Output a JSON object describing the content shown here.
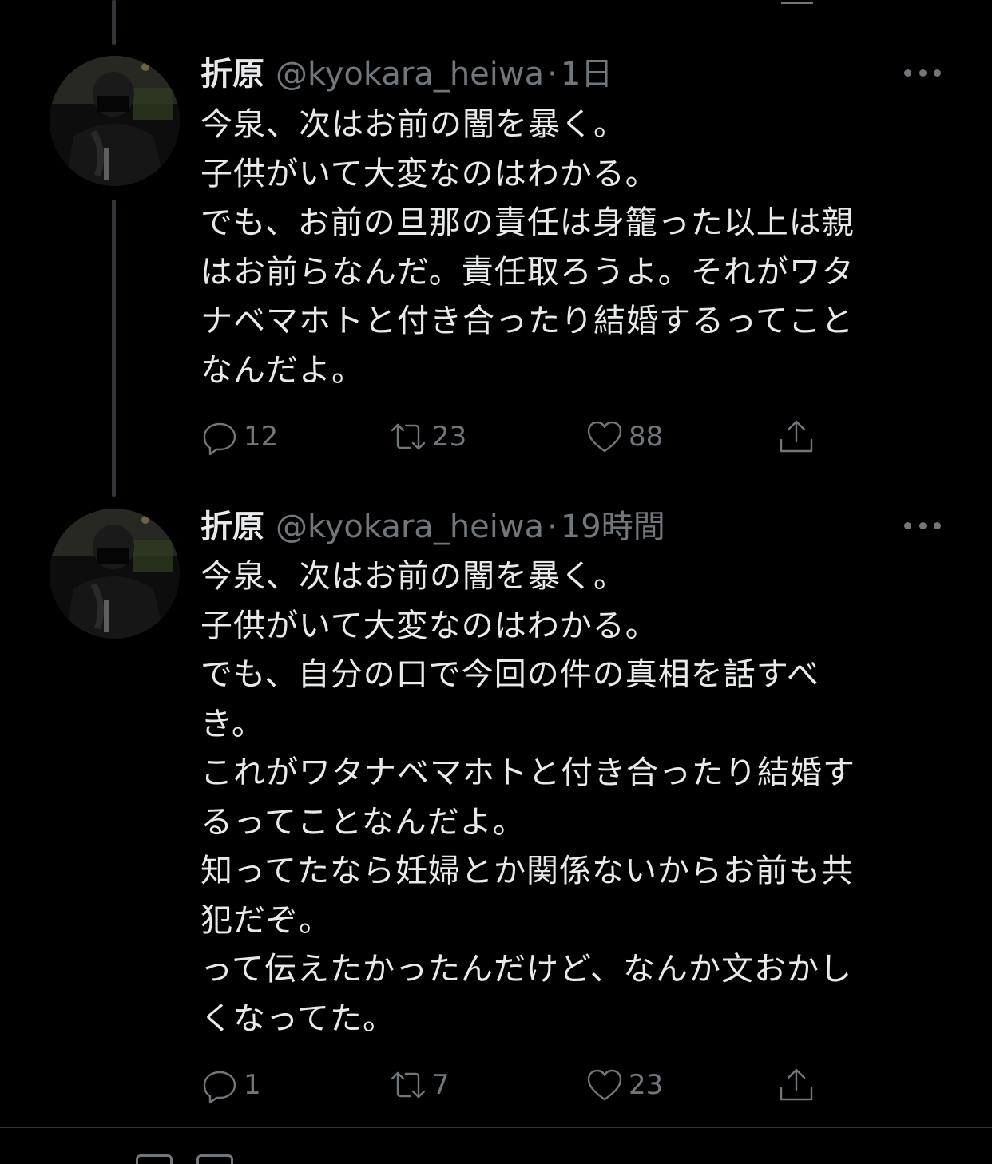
{
  "tweets": [
    {
      "name": "折原",
      "handle": "@kyokara_heiwa",
      "separator": "·",
      "time": "1日",
      "lines": [
        "今泉、次はお前の闇を暴く。",
        "子供がいて大変なのはわかる。",
        "でも、お前の旦那の責任は身籠った以上は親",
        "はお前らなんだ。責任取ろうよ。それがワタ",
        "ナベマホトと付き合ったり結婚するってこと",
        "なんだよ。"
      ],
      "reply_count": "12",
      "retweet_count": "23",
      "like_count": "88"
    },
    {
      "name": "折原",
      "handle": "@kyokara_heiwa",
      "separator": "·",
      "time": "19時間",
      "lines": [
        "今泉、次はお前の闇を暴く。",
        "子供がいて大変なのはわかる。",
        "でも、自分の口で今回の件の真相を話すべ",
        "き。",
        "これがワタナベマホトと付き合ったり結婚す",
        "るってことなんだよ。",
        "知ってたなら妊婦とか関係ないからお前も共",
        "犯だぞ。",
        "って伝えたかったんだけど、なんか文おかし",
        "くなってた。"
      ],
      "reply_count": "1",
      "retweet_count": "7",
      "like_count": "23"
    }
  ],
  "icons": {
    "reply": "reply-icon",
    "retweet": "retweet-icon",
    "like": "heart-icon",
    "share": "share-icon",
    "more": "more-icon"
  },
  "colors": {
    "background": "#000000",
    "text": "#e7e9ea",
    "secondary": "#71767b",
    "thread_line": "#333639"
  }
}
